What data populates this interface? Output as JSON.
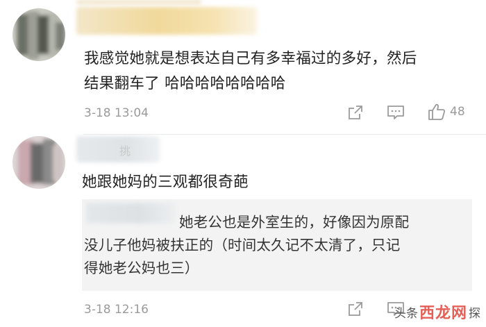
{
  "comments": [
    {
      "text_lines": [
        "我感觉她就是想表达自己有多幸福过的多好，然后",
        "结果翻车了 哈哈哈哈哈哈哈哈"
      ],
      "time": "3-18 13:04",
      "likes": "48",
      "icons": [
        "share-icon",
        "reply-icon",
        "like-icon"
      ]
    },
    {
      "username_partial": "挑",
      "text_lines": [
        "她跟她妈的三观都很奇葩"
      ],
      "quote_lines": [
        "她老公也是外室生的，好像因为原配",
        "没儿子他妈被扶正的（时间太久记不太清了，只记",
        "得她老公妈也三）"
      ],
      "time": "3-18 12:16",
      "icons": [
        "share-icon",
        "reply-icon"
      ]
    }
  ],
  "watermark": {
    "prefix": "头条",
    "logo": "西龙网",
    "suffix": "探"
  },
  "colors": {
    "text": "#222222",
    "meta": "#9a9a9a",
    "quote_bg": "#f3f3f3",
    "watermark_logo": "#e0443a"
  }
}
